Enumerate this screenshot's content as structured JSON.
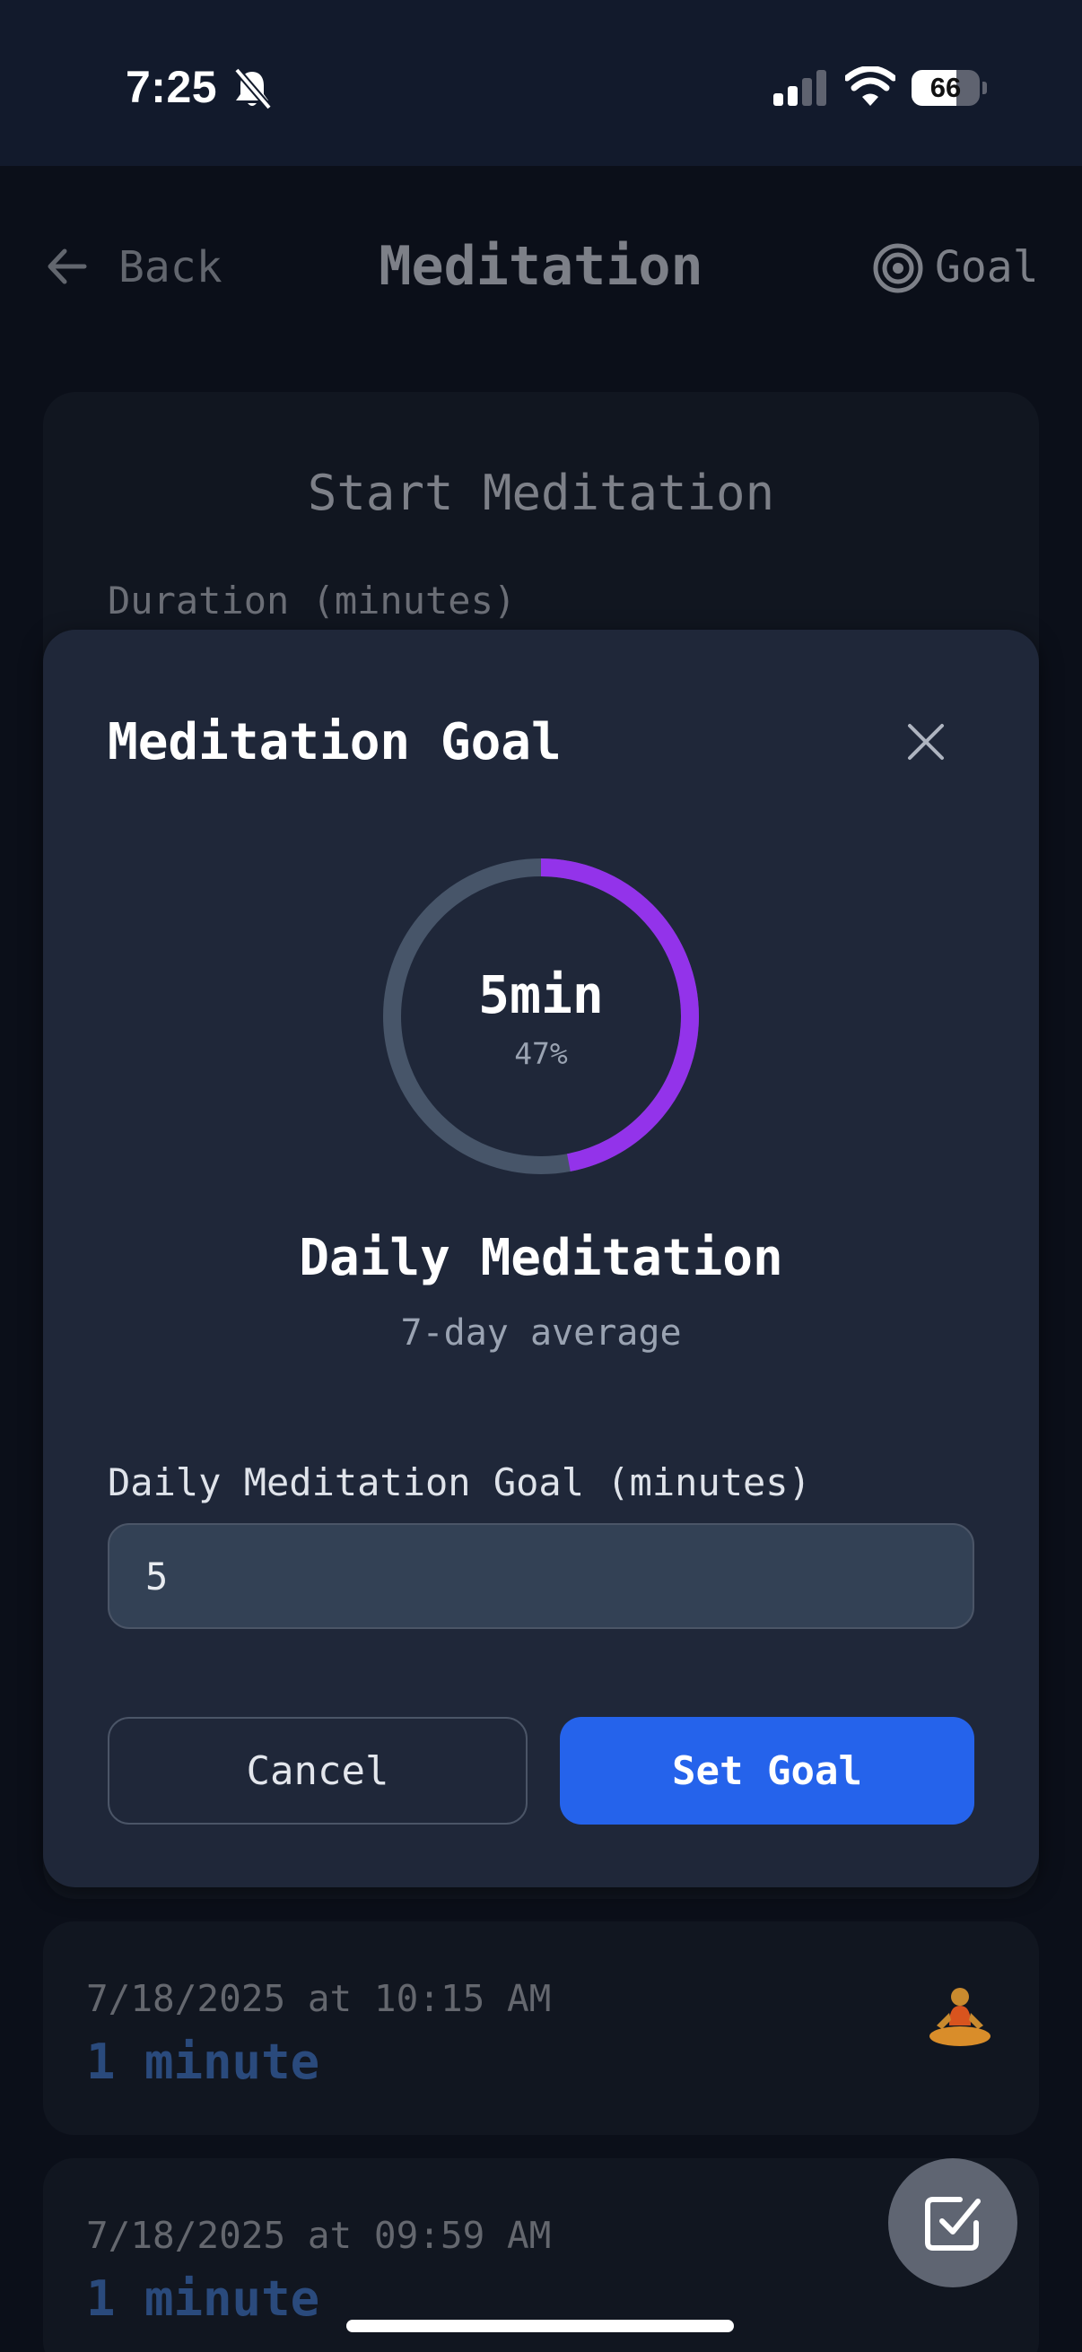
{
  "status_bar": {
    "time": "7:25",
    "battery_level": "66",
    "battery_fraction": 0.66
  },
  "header": {
    "back_label": "Back",
    "title": "Meditation",
    "goal_label": "Goal"
  },
  "start_card": {
    "title": "Start Meditation",
    "duration_label": "Duration (minutes)"
  },
  "goal_modal": {
    "title": "Meditation Goal",
    "ring_value": "5min",
    "ring_percent": "47%",
    "progress_fraction": 0.47,
    "caption": "Daily Meditation",
    "subcaption": "7-day average",
    "field_label": "Daily Meditation Goal (minutes)",
    "field_value": "5",
    "cancel_label": "Cancel",
    "submit_label": "Set Goal",
    "accent_color": "#9333ea",
    "button_color": "#2563eb"
  },
  "history": [
    {
      "date": "7/18/2025 at 10:15 AM",
      "duration": "1 minute"
    },
    {
      "date": "7/18/2025 at 09:59 AM",
      "duration": "1 minute"
    }
  ],
  "icons": {
    "back": "arrow-left",
    "goal": "target",
    "close": "x",
    "entry": "person-in-lotus-position",
    "fab": "check-square"
  }
}
